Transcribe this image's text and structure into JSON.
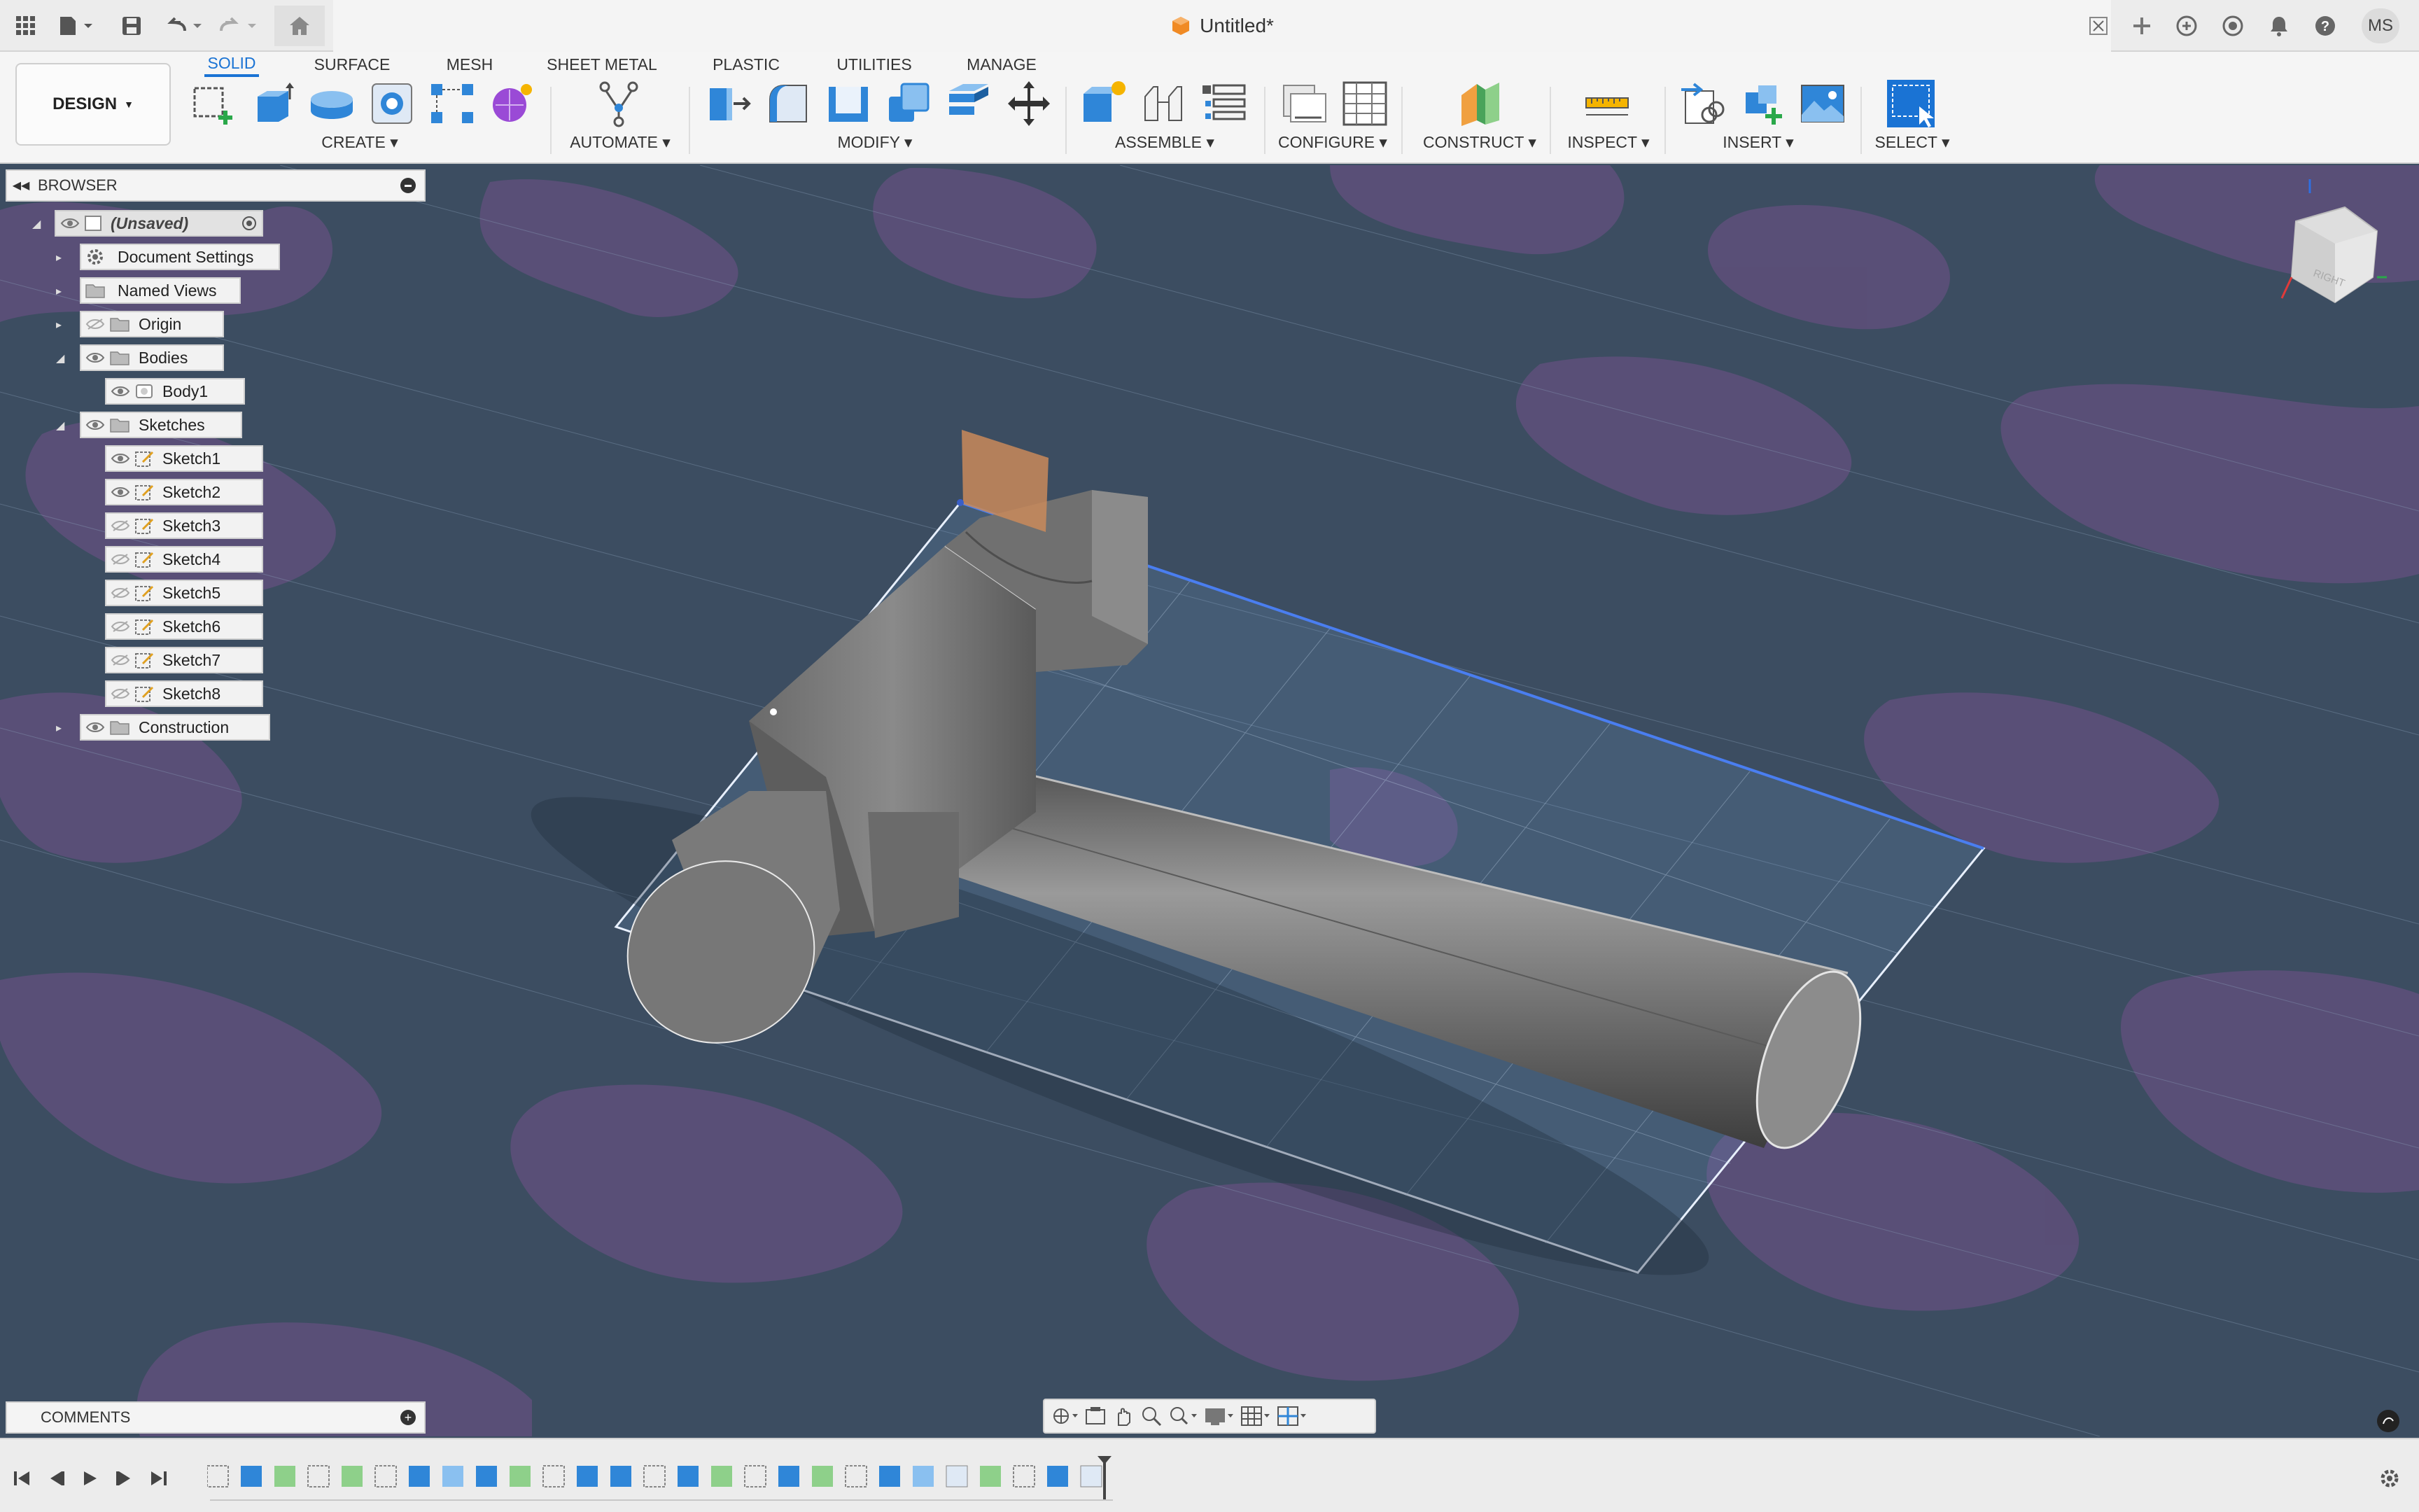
{
  "window": {
    "title": "Untitled*",
    "user_initials": "MS"
  },
  "ribbon": {
    "workspace": "DESIGN",
    "tabs": [
      "SOLID",
      "SURFACE",
      "MESH",
      "SHEET METAL",
      "PLASTIC",
      "UTILITIES",
      "MANAGE"
    ],
    "active_tab": "SOLID",
    "groups": [
      "CREATE",
      "AUTOMATE",
      "MODIFY",
      "ASSEMBLE",
      "CONFIGURE",
      "CONSTRUCT",
      "INSPECT",
      "INSERT",
      "SELECT"
    ]
  },
  "browser": {
    "title": "BROWSER",
    "root": "(Unsaved)",
    "items": [
      {
        "label": "Document Settings",
        "icon": "gear-icon"
      },
      {
        "label": "Named Views",
        "icon": "folder-icon"
      },
      {
        "label": "Origin",
        "icon": "folder-icon"
      },
      {
        "label": "Bodies",
        "icon": "folder-icon"
      },
      {
        "label": "Body1",
        "icon": "body-icon"
      },
      {
        "label": "Sketches",
        "icon": "folder-icon"
      },
      {
        "label": "Sketch1",
        "icon": "sketch-icon"
      },
      {
        "label": "Sketch2",
        "icon": "sketch-icon"
      },
      {
        "label": "Sketch3",
        "icon": "sketch-icon"
      },
      {
        "label": "Sketch4",
        "icon": "sketch-icon"
      },
      {
        "label": "Sketch5",
        "icon": "sketch-icon"
      },
      {
        "label": "Sketch6",
        "icon": "sketch-icon"
      },
      {
        "label": "Sketch7",
        "icon": "sketch-icon"
      },
      {
        "label": "Sketch8",
        "icon": "sketch-icon"
      },
      {
        "label": "Construction",
        "icon": "folder-icon"
      }
    ]
  },
  "viewcube": {
    "face": "RIGHT"
  },
  "comments": {
    "title": "COMMENTS"
  },
  "colors": {
    "accent": "#1a73d4",
    "viewport_bg": "#3c4d61",
    "camo": "#5b4f78",
    "sketch_plane": "#6f9ed0"
  }
}
